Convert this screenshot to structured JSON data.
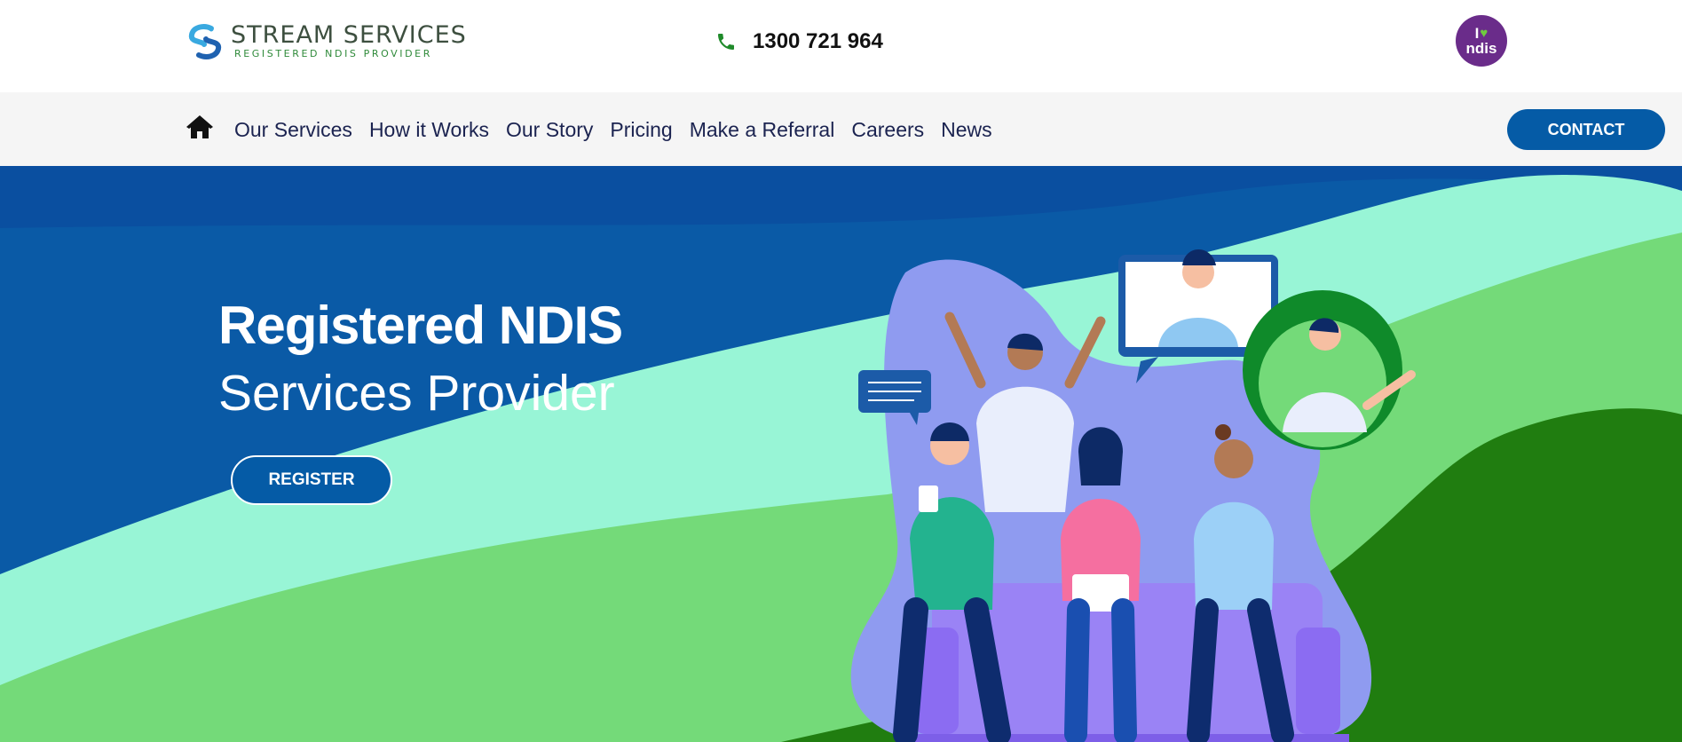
{
  "header": {
    "logo": {
      "name": "STREAM SERVICES",
      "tagline": "REGISTERED NDIS PROVIDER"
    },
    "phone": {
      "icon": "phone-icon",
      "number": "1300 721 964"
    },
    "badge": {
      "top": "I",
      "text": "ndis",
      "icon": "heart-icon"
    }
  },
  "nav": {
    "home_icon": "home-icon",
    "items": [
      {
        "label": "Our Services"
      },
      {
        "label": "How it Works"
      },
      {
        "label": "Our Story"
      },
      {
        "label": "Pricing"
      },
      {
        "label": "Make a Referral"
      },
      {
        "label": "Careers"
      },
      {
        "label": "News"
      }
    ],
    "contact_label": "CONTACT"
  },
  "hero": {
    "title_line1": "Registered NDIS",
    "title_line2": "Services Provider",
    "register_label": "REGISTER"
  },
  "colors": {
    "primary_blue": "#055ba6",
    "dark_blue": "#0a4fa0",
    "mint": "#98f5d6",
    "light_green": "#74da79",
    "dark_green": "#207d10",
    "nav_text": "#1b2350",
    "ndis_purple": "#6a2c8a"
  }
}
